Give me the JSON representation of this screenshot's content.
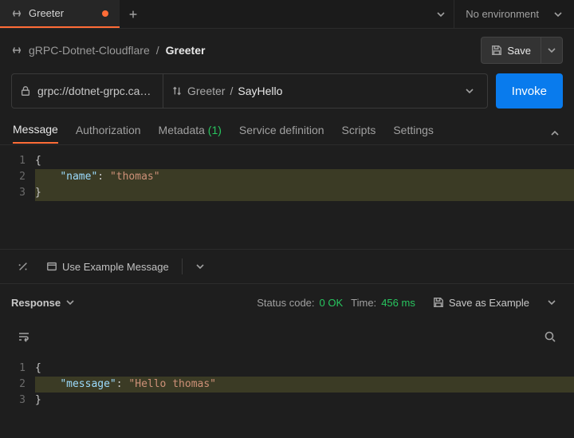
{
  "tab": {
    "label": "Greeter"
  },
  "env": {
    "label": "No environment"
  },
  "breadcrumb": {
    "parent": "gRPC-Dotnet-Cloudflare",
    "sep": "/",
    "current": "Greeter"
  },
  "save": {
    "label": "Save"
  },
  "url": {
    "value": "grpc://dotnet-grpc.ca…"
  },
  "method": {
    "service": "Greeter",
    "sep": "/",
    "method": "SayHello"
  },
  "invoke": {
    "label": "Invoke"
  },
  "reqTabs": {
    "message": "Message",
    "authorization": "Authorization",
    "metadata": "Metadata",
    "metadataCount": "(1)",
    "serviceDef": "Service definition",
    "scripts": "Scripts",
    "settings": "Settings"
  },
  "requestBody": {
    "lines": [
      "1",
      "2",
      "3"
    ],
    "l1": "{",
    "l2_indent": "    ",
    "l2_key": "\"name\"",
    "l2_colon": ": ",
    "l2_val": "\"thomas\"",
    "l3": "}"
  },
  "reqToolbar": {
    "useExample": "Use Example Message"
  },
  "response": {
    "title": "Response",
    "statusLabel": "Status code:",
    "statusValue": "0 OK",
    "timeLabel": "Time:",
    "timeValue": "456 ms",
    "saveExample": "Save as Example"
  },
  "responseBody": {
    "lines": [
      "1",
      "2",
      "3"
    ],
    "l1": "{",
    "l2_indent": "    ",
    "l2_key": "\"message\"",
    "l2_colon": ": ",
    "l2_val": "\"Hello thomas\"",
    "l3": "}"
  }
}
